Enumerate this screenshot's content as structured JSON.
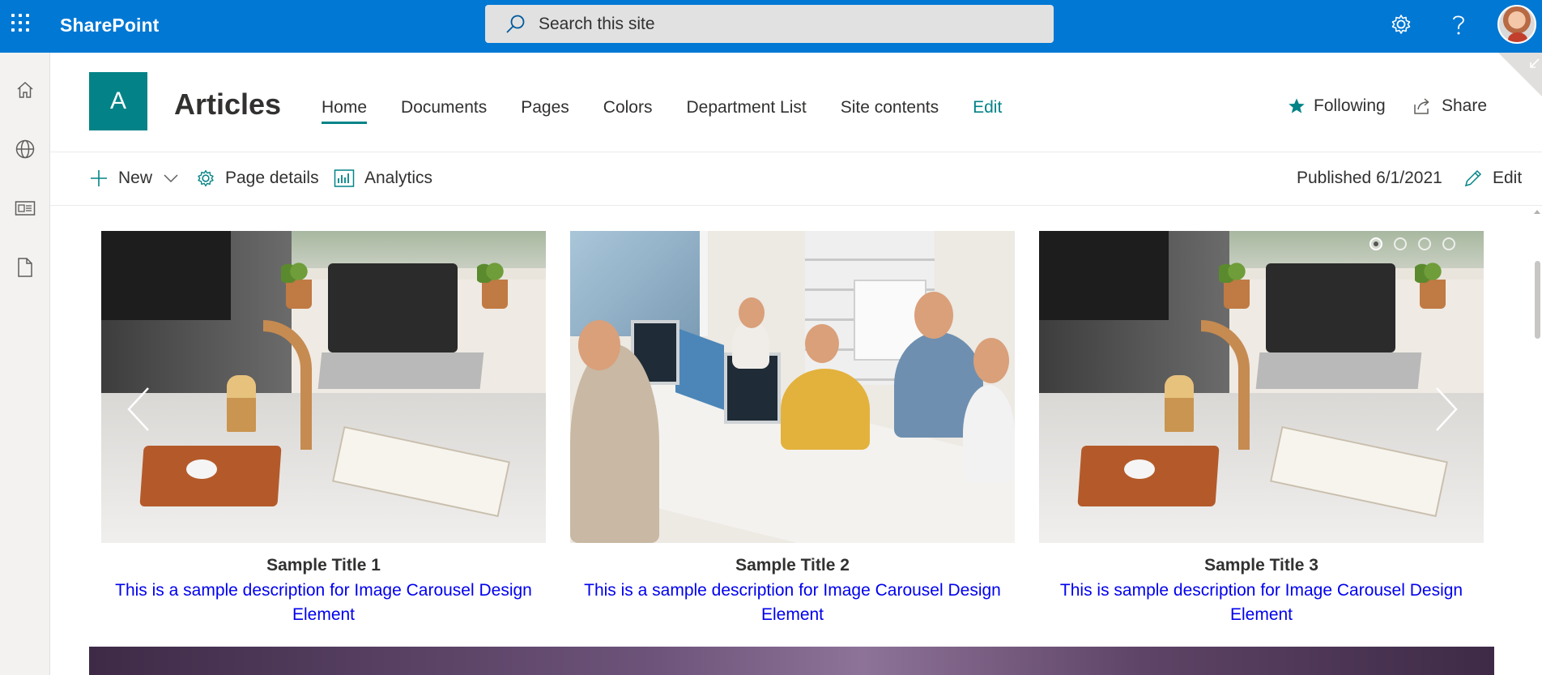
{
  "suitebar": {
    "brand": "SharePoint",
    "search_placeholder": "Search this site",
    "colors": {
      "background": "#0078d4"
    }
  },
  "appbar": {
    "items": [
      {
        "icon": "home-icon"
      },
      {
        "icon": "globe-icon"
      },
      {
        "icon": "news-icon"
      },
      {
        "icon": "document-icon"
      }
    ]
  },
  "site": {
    "logo_letter": "A",
    "title": "Articles",
    "accent": "#038387",
    "nav": [
      {
        "label": "Home",
        "active": true
      },
      {
        "label": "Documents"
      },
      {
        "label": "Pages"
      },
      {
        "label": "Colors"
      },
      {
        "label": "Department List"
      },
      {
        "label": "Site contents"
      },
      {
        "label": "Edit",
        "is_edit": true
      }
    ],
    "following_label": "Following",
    "share_label": "Share"
  },
  "commandbar": {
    "new_label": "New",
    "page_details_label": "Page details",
    "analytics_label": "Analytics",
    "published_label": "Published 6/1/2021",
    "edit_label": "Edit"
  },
  "carousel": {
    "slides": [
      {
        "title": "Sample Title 1",
        "description": "This is a sample description for Image Carousel Design Element",
        "image": "office-desk-photo"
      },
      {
        "title": "Sample Title 2",
        "description": "This is a sample description for Image Carousel Design Element",
        "image": "team-meeting-photo"
      },
      {
        "title": "Sample Title 3",
        "description": "This is sample description for Image Carousel Design Element",
        "image": "office-desk-photo"
      }
    ],
    "dot_count": 4,
    "active_dot": 0,
    "link_color": "#0000ee"
  }
}
